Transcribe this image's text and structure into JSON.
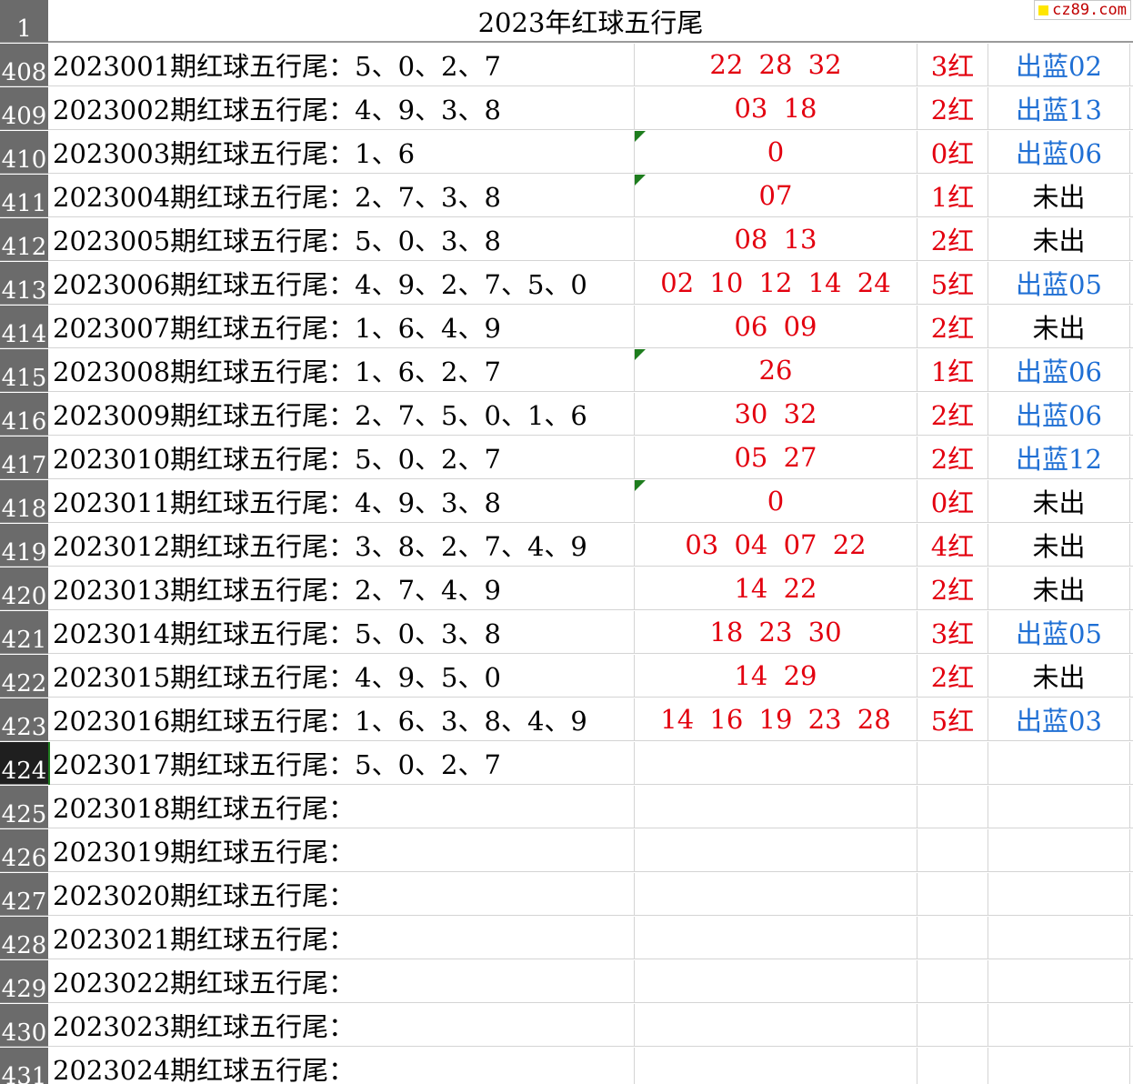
{
  "header_row": {
    "num": "1",
    "title": "2023年红球五行尾"
  },
  "brand": {
    "text": "cz89.com",
    "square_color": "#ffe600"
  },
  "colors": {
    "red": "#e3000f",
    "blue": "#1f6fd4",
    "row_header_bg": "#6b6b6b",
    "active_row_header_bg": "#1f1f1f",
    "comment_marker": "#1e7d1e"
  },
  "rows": [
    {
      "num": "408",
      "desc": "2023001期红球五行尾：5、0、2、7",
      "hits": "22 28 32",
      "count": "3红",
      "blue": "出蓝02",
      "blue_out": true,
      "marker": false
    },
    {
      "num": "409",
      "desc": "2023002期红球五行尾：4、9、3、8",
      "hits": "03 18",
      "count": "2红",
      "blue": "出蓝13",
      "blue_out": true,
      "marker": false
    },
    {
      "num": "410",
      "desc": "2023003期红球五行尾：1、6",
      "hits": "0",
      "count": "0红",
      "blue": "出蓝06",
      "blue_out": true,
      "marker": true
    },
    {
      "num": "411",
      "desc": "2023004期红球五行尾：2、7、3、8",
      "hits": "07",
      "count": "1红",
      "blue": "未出",
      "blue_out": false,
      "marker": true
    },
    {
      "num": "412",
      "desc": "2023005期红球五行尾：5、0、3、8",
      "hits": "08 13",
      "count": "2红",
      "blue": "未出",
      "blue_out": false,
      "marker": false
    },
    {
      "num": "413",
      "desc": "2023006期红球五行尾：4、9、2、7、5、0",
      "hits": "02 10 12 14 24",
      "count": "5红",
      "blue": "出蓝05",
      "blue_out": true,
      "marker": false
    },
    {
      "num": "414",
      "desc": "2023007期红球五行尾：1、6、4、9",
      "hits": "06 09",
      "count": "2红",
      "blue": "未出",
      "blue_out": false,
      "marker": false
    },
    {
      "num": "415",
      "desc": "2023008期红球五行尾：1、6、2、7",
      "hits": "26",
      "count": "1红",
      "blue": "出蓝06",
      "blue_out": true,
      "marker": true
    },
    {
      "num": "416",
      "desc": "2023009期红球五行尾：2、7、5、0、1、6",
      "hits": "30 32",
      "count": "2红",
      "blue": "出蓝06",
      "blue_out": true,
      "marker": false
    },
    {
      "num": "417",
      "desc": "2023010期红球五行尾：5、0、2、7",
      "hits": "05 27",
      "count": "2红",
      "blue": "出蓝12",
      "blue_out": true,
      "marker": false
    },
    {
      "num": "418",
      "desc": "2023011期红球五行尾：4、9、3、8",
      "hits": "0",
      "count": "0红",
      "blue": "未出",
      "blue_out": false,
      "marker": true
    },
    {
      "num": "419",
      "desc": "2023012期红球五行尾：3、8、2、7、4、9",
      "hits": "03 04 07 22",
      "count": "4红",
      "blue": "未出",
      "blue_out": false,
      "marker": false
    },
    {
      "num": "420",
      "desc": "2023013期红球五行尾：2、7、4、9",
      "hits": "14 22",
      "count": "2红",
      "blue": "未出",
      "blue_out": false,
      "marker": false
    },
    {
      "num": "421",
      "desc": "2023014期红球五行尾：5、0、3、8",
      "hits": "18 23 30",
      "count": "3红",
      "blue": "出蓝05",
      "blue_out": true,
      "marker": false
    },
    {
      "num": "422",
      "desc": "2023015期红球五行尾：4、9、5、0",
      "hits": "14 29",
      "count": "2红",
      "blue": "未出",
      "blue_out": false,
      "marker": false
    },
    {
      "num": "423",
      "desc": "2023016期红球五行尾：1、6、3、8、4、9",
      "hits": "14 16 19 23 28",
      "count": "5红",
      "blue": "出蓝03",
      "blue_out": true,
      "marker": false
    },
    {
      "num": "424",
      "desc": "2023017期红球五行尾：5、0、2、7",
      "hits": "",
      "count": "",
      "blue": "",
      "blue_out": false,
      "marker": false,
      "active": true
    },
    {
      "num": "425",
      "desc": "2023018期红球五行尾：",
      "hits": "",
      "count": "",
      "blue": "",
      "blue_out": false,
      "marker": false
    },
    {
      "num": "426",
      "desc": "2023019期红球五行尾：",
      "hits": "",
      "count": "",
      "blue": "",
      "blue_out": false,
      "marker": false
    },
    {
      "num": "427",
      "desc": "2023020期红球五行尾：",
      "hits": "",
      "count": "",
      "blue": "",
      "blue_out": false,
      "marker": false
    },
    {
      "num": "428",
      "desc": "2023021期红球五行尾：",
      "hits": "",
      "count": "",
      "blue": "",
      "blue_out": false,
      "marker": false
    },
    {
      "num": "429",
      "desc": "2023022期红球五行尾：",
      "hits": "",
      "count": "",
      "blue": "",
      "blue_out": false,
      "marker": false
    },
    {
      "num": "430",
      "desc": "2023023期红球五行尾：",
      "hits": "",
      "count": "",
      "blue": "",
      "blue_out": false,
      "marker": false
    },
    {
      "num": "431",
      "desc": "2023024期红球五行尾：",
      "hits": "",
      "count": "",
      "blue": "",
      "blue_out": false,
      "marker": false
    }
  ]
}
